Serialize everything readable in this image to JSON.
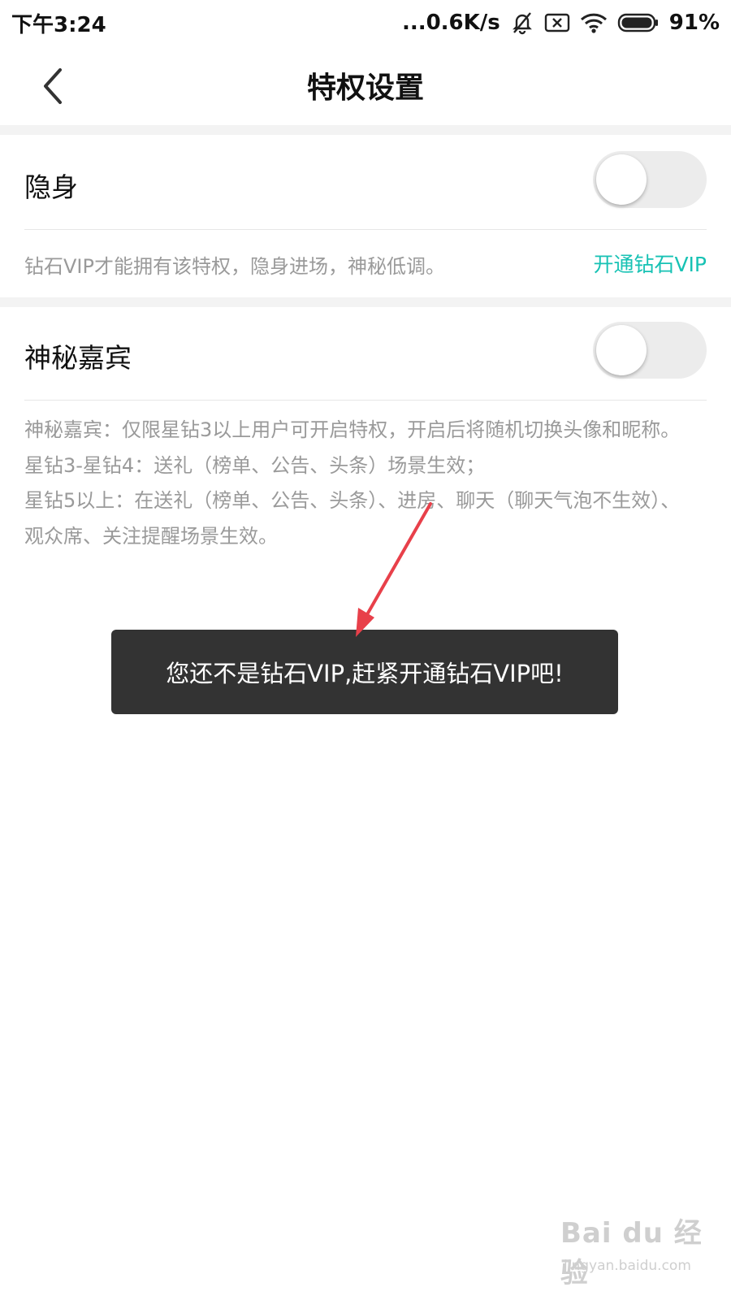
{
  "status_bar": {
    "time": "下午3:24",
    "network_speed": "...0.6K/s",
    "battery_percent": "91%",
    "icons": [
      "bell-off-icon",
      "sim-x-icon",
      "wifi-icon",
      "battery-icon"
    ]
  },
  "nav": {
    "back_icon": "chevron-left-icon",
    "title": "特权设置"
  },
  "invisible": {
    "label": "隐身",
    "toggle_on": false,
    "hint": "钻石VIP才能拥有该特权，隐身进场，神秘低调。",
    "link": "开通钻石VIP"
  },
  "mystery_guest": {
    "label": "神秘嘉宾",
    "toggle_on": false,
    "desc_lines": [
      "神秘嘉宾：仅限星钻3以上用户可开启特权，开启后将随机切换头像和昵称。",
      "星钻3-星钻4：送礼（榜单、公告、头条）场景生效；",
      "星钻5以上：在送礼（榜单、公告、头条）、进房、聊天（聊天气泡不生效）、观众席、关注提醒场景生效。"
    ]
  },
  "toast": {
    "message": "您还不是钻石VIP,赶紧开通钻石VIP吧!"
  },
  "watermark": {
    "brand": "Bai du 经验",
    "url": "jingyan.baidu.com"
  },
  "colors": {
    "accent": "#17c2b4",
    "toast_bg": "#333333",
    "annotation_arrow": "#e8404a"
  }
}
